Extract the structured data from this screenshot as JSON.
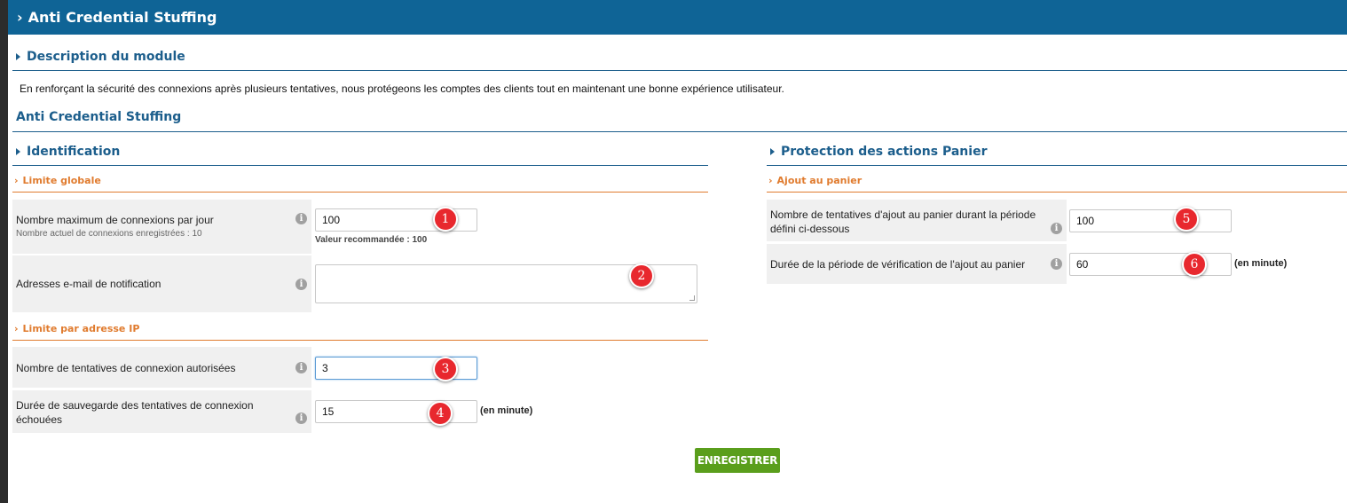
{
  "header": {
    "title": "Anti Credential Stuffing"
  },
  "description": {
    "title": "Description du module",
    "text": "En renforçant la sécurité des connexions après plusieurs tentatives, nous protégeons les comptes des clients tout en maintenant une bonne expérience utilisateur."
  },
  "module_title": "Anti Credential Stuffing",
  "identification": {
    "title": "Identification",
    "global_limit": {
      "title": "Limite globale",
      "max_connections": {
        "label": "Nombre maximum de connexions par jour",
        "sublabel": "Nombre actuel de connexions enregistrées : 10",
        "value": "100",
        "hint": "Valeur recommandée : 100",
        "badge": "1"
      },
      "notification_emails": {
        "label": "Adresses e-mail de notification",
        "value": "",
        "badge": "2"
      }
    },
    "ip_limit": {
      "title": "Limite par adresse IP",
      "attempts_allowed": {
        "label": "Nombre de tentatives de connexion autorisées",
        "value": "3",
        "badge": "3"
      },
      "failed_retention": {
        "label_line1": "Durée de sauvegarde des tentatives de connexion",
        "label_line2": "échouées",
        "value": "15",
        "unit": "(en minute)",
        "badge": "4"
      }
    }
  },
  "cart_protection": {
    "title": "Protection des actions Panier",
    "add_to_cart": {
      "title": "Ajout au panier",
      "attempts": {
        "label_line1": "Nombre de tentatives d'ajout au panier durant la période",
        "label_line2": "défini ci-dessous",
        "value": "100",
        "badge": "5"
      },
      "period": {
        "label": "Durée de la période de vérification de l'ajout au panier",
        "value": "60",
        "unit": "(en minute)",
        "badge": "6"
      }
    }
  },
  "save_button": "ENREGISTRER",
  "info_icon_glyph": "i",
  "colors": {
    "header": "#0f6496",
    "section_title": "#1c5e8c",
    "subsection": "#e07b2e",
    "save": "#5a9e1c",
    "badge": "#e8282e"
  }
}
